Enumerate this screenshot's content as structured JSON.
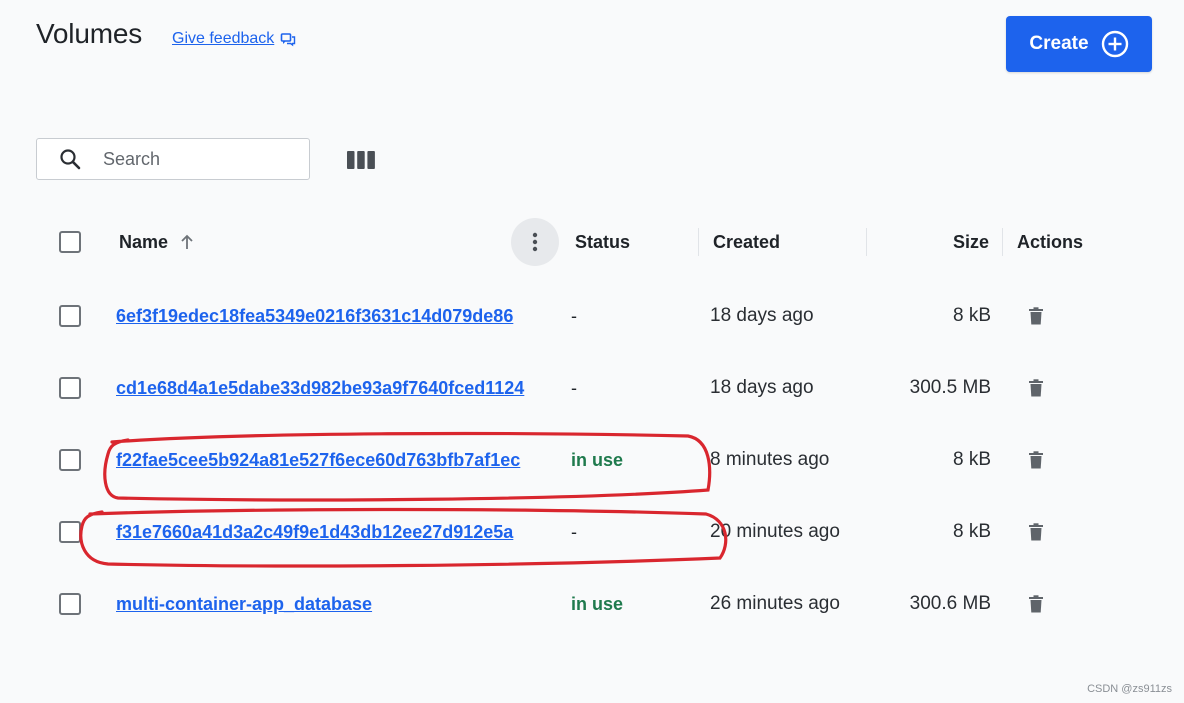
{
  "page": {
    "title": "Volumes",
    "feedback_label": "Give feedback",
    "create_label": "Create"
  },
  "search": {
    "placeholder": "Search"
  },
  "table": {
    "columns": {
      "name": "Name",
      "status": "Status",
      "created": "Created",
      "size": "Size",
      "actions": "Actions"
    },
    "rows": [
      {
        "name": "6ef3f19edec18fea5349e0216f3631c14d079de86",
        "status": "-",
        "created": "18 days ago",
        "size": "8 kB"
      },
      {
        "name": "cd1e68d4a1e5dabe33d982be93a9f7640fced1124",
        "status": "-",
        "created": "18 days ago",
        "size": "300.5 MB"
      },
      {
        "name": "f22fae5cee5b924a81e527f6ece60d763bfb7af1ec",
        "status": "in use",
        "created": "8 minutes ago",
        "size": "8 kB"
      },
      {
        "name": "f31e7660a41d3a2c49f9e1d43db12ee27d912e5a",
        "status": "-",
        "created": "20 minutes ago",
        "size": "8 kB"
      },
      {
        "name": "multi-container-app_database",
        "status": "in use",
        "created": "26 minutes ago",
        "size": "300.6 MB"
      }
    ]
  },
  "colors": {
    "accent": "#1d63ed",
    "in_use": "#1f7a4d",
    "annotation": "#d9262e"
  },
  "icons": {
    "feedback": "feedback-icon",
    "create": "plus-circle-icon",
    "search": "search-icon",
    "columns": "columns-icon",
    "sort": "arrow-up-icon",
    "kebab": "kebab-icon",
    "delete": "trash-icon"
  },
  "watermark": "CSDN @zs911zs"
}
